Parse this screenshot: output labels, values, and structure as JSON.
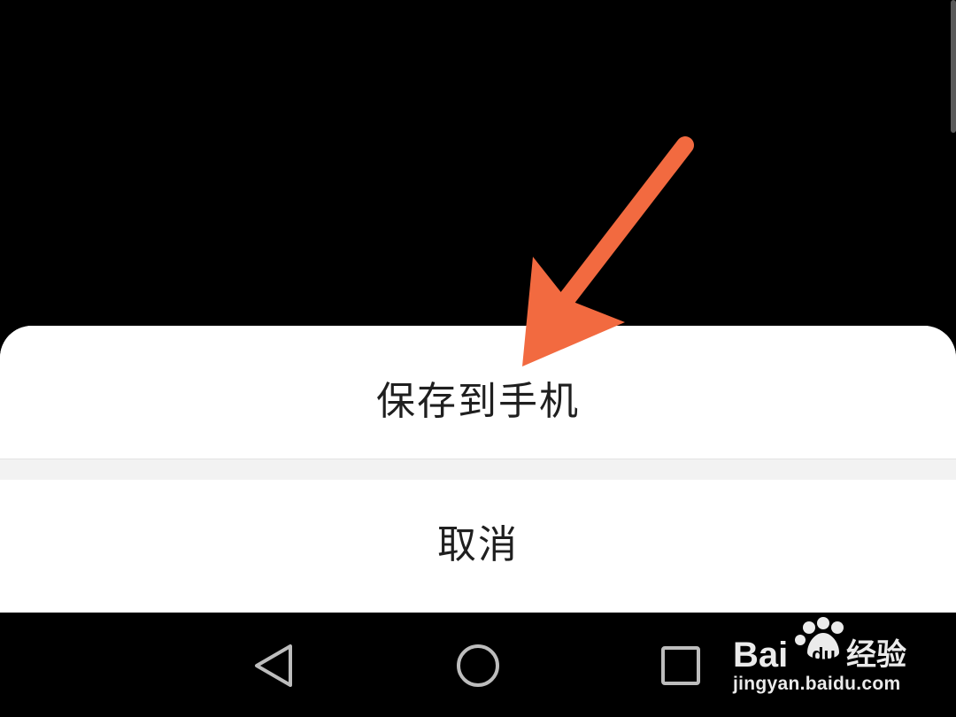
{
  "sheet": {
    "options": [
      {
        "label": "保存到手机"
      },
      {
        "label": "取消"
      }
    ]
  },
  "navbar": {
    "buttons": [
      "back-icon",
      "home-icon",
      "recents-icon"
    ]
  },
  "annotation": {
    "arrow_color": "#F26A40"
  },
  "watermark": {
    "logo_text": "Bai du 经验",
    "url": "jingyan.baidu.com"
  },
  "colors": {
    "background": "#000000",
    "sheet": "#FFFFFF",
    "divider": "#F2F2F2",
    "text": "#1F1F1F",
    "nav_icon": "#BDBDBD"
  }
}
